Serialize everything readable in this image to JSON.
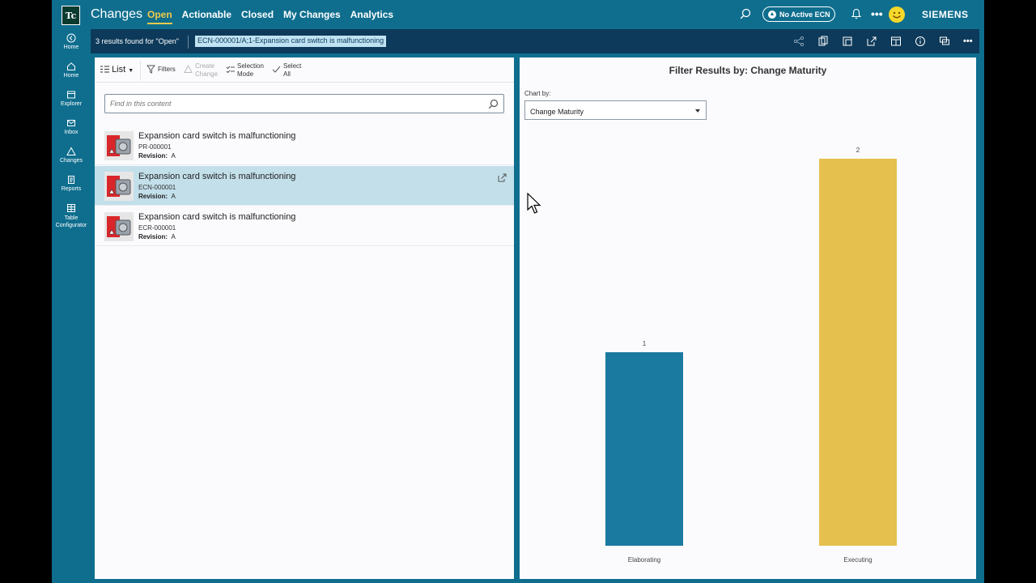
{
  "topbar": {
    "logo": "Tc",
    "app_title": "Changes",
    "nav": [
      {
        "label": "Open",
        "active": true
      },
      {
        "label": "Actionable",
        "active": false
      },
      {
        "label": "Closed",
        "active": false
      },
      {
        "label": "My Changes",
        "active": false
      },
      {
        "label": "Analytics",
        "active": false
      }
    ],
    "ecn_status": "No Active ECN",
    "brand": "SIEMENS",
    "accent_color": "#f2c94c",
    "bg_color": "#0f6e8e"
  },
  "rail": {
    "items": [
      {
        "label": "Home",
        "icon": "back-home-icon"
      },
      {
        "label": "Home",
        "icon": "home-icon"
      },
      {
        "label": "Explorer",
        "icon": "explorer-icon"
      },
      {
        "label": "Inbox",
        "icon": "inbox-icon"
      },
      {
        "label": "Changes",
        "icon": "changes-icon"
      },
      {
        "label": "Reports",
        "icon": "reports-icon"
      },
      {
        "label": "Table Configurator",
        "icon": "table-icon"
      }
    ]
  },
  "subbar": {
    "results_text": "3 results found for \"Open\"",
    "selected_chip": "ECN-000001/A;1-Expansion card switch is malfunctioning"
  },
  "left": {
    "toolbar": {
      "list_label": "List",
      "filters_label": "Filters",
      "create_change_label_1": "Create",
      "create_change_label_2": "Change",
      "selection_mode_label_1": "Selection",
      "selection_mode_label_2": "Mode",
      "select_all_label_1": "Select",
      "select_all_label_2": "All"
    },
    "search_placeholder": "Find in this content",
    "rows": [
      {
        "name": "Expansion card switch is malfunctioning",
        "id": "PR-000001",
        "revision_label": "Revision:",
        "revision": "A",
        "selected": false
      },
      {
        "name": "Expansion card switch is malfunctioning",
        "id": "ECN-000001",
        "revision_label": "Revision:",
        "revision": "A",
        "selected": true
      },
      {
        "name": "Expansion card switch is malfunctioning",
        "id": "ECR-000001",
        "revision_label": "Revision:",
        "revision": "A",
        "selected": false
      }
    ]
  },
  "right": {
    "title": "Filter Results by: Change Maturity",
    "chart_by_label": "Chart by:",
    "chart_by_value": "Change Maturity"
  },
  "chart_data": {
    "type": "bar",
    "categories": [
      "Elaborating",
      "Executing"
    ],
    "values": [
      1,
      2
    ],
    "colors": [
      "#1b7aa0",
      "#e6c04f"
    ],
    "ylim": [
      0,
      2
    ],
    "grid": false,
    "data_labels": true
  }
}
